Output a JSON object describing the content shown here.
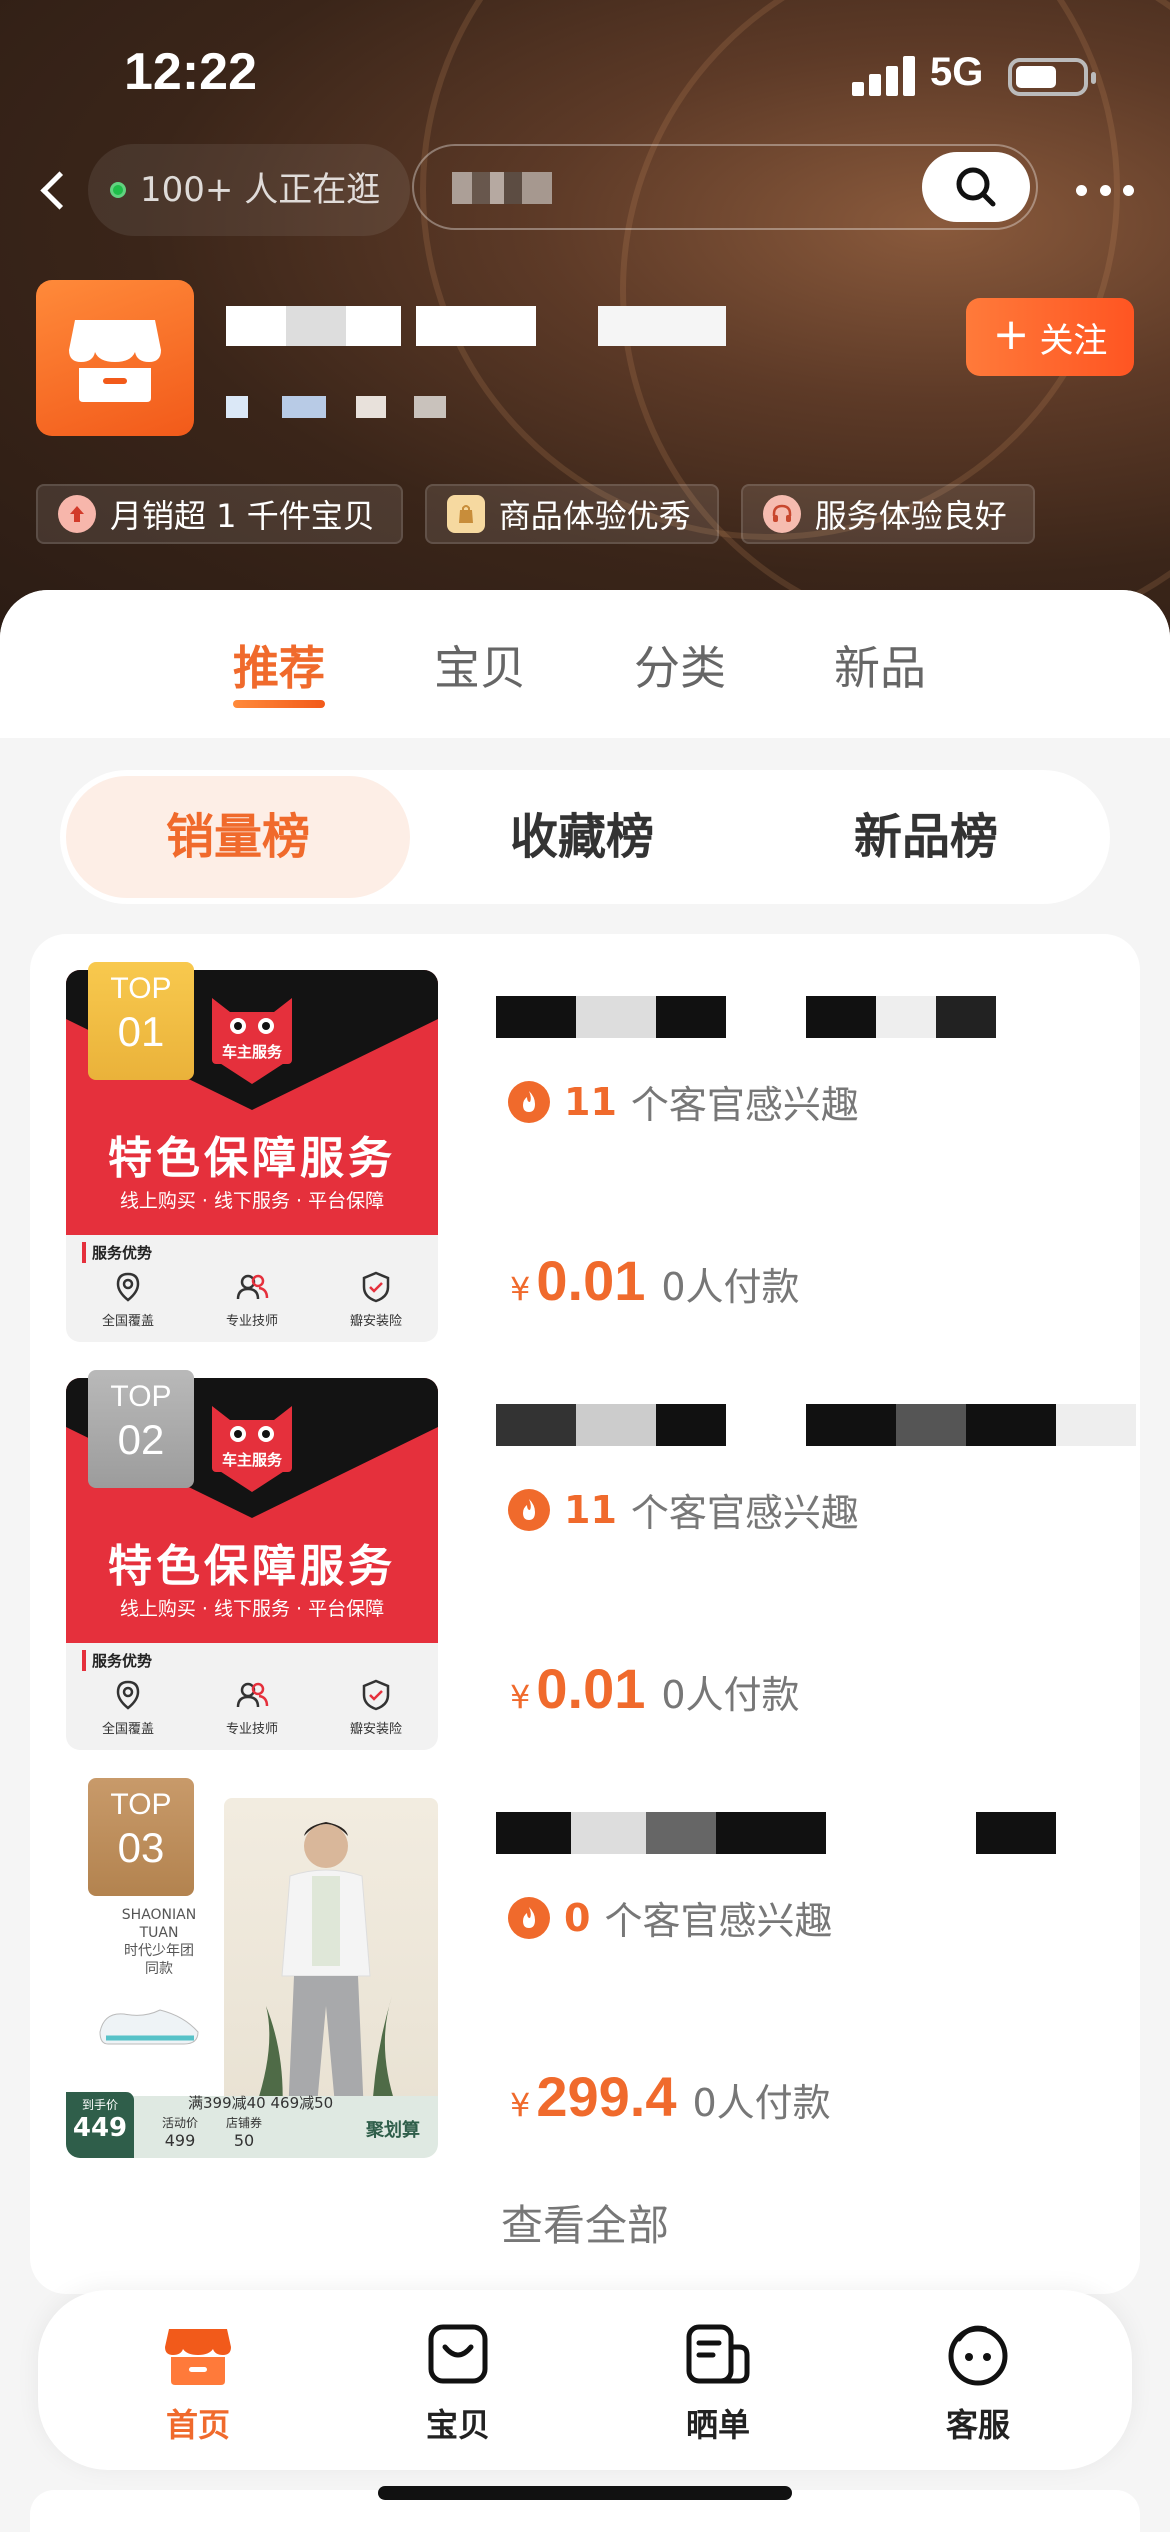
{
  "status_bar": {
    "time": "12:22",
    "network": "5G"
  },
  "nav": {
    "visitors": "100+ 人正在逛",
    "search_placeholder": "",
    "back": "back",
    "more": "more"
  },
  "shop": {
    "name": "",
    "subtitle": "",
    "follow_label": "关注",
    "follow_icon": "plus-icon"
  },
  "badges": [
    {
      "label": "月销超 1 千件宝贝",
      "icon": "arrow-up-icon"
    },
    {
      "label": "商品体验优秀",
      "icon": "shopping-bag-icon"
    },
    {
      "label": "服务体验良好",
      "icon": "headset-icon"
    }
  ],
  "tabs": [
    {
      "label": "推荐",
      "active": true
    },
    {
      "label": "宝贝",
      "active": false
    },
    {
      "label": "分类",
      "active": false
    },
    {
      "label": "新品",
      "active": false
    }
  ],
  "rank_tabs": [
    {
      "label": "销量榜",
      "active": true
    },
    {
      "label": "收藏榜",
      "active": false
    },
    {
      "label": "新品榜",
      "active": false
    }
  ],
  "products": [
    {
      "rank_top": "TOP",
      "rank_no": "01",
      "thumb": {
        "brand": "车主服务",
        "title": "特色保障服务",
        "subtitle": "线上购买 · 线下服务 · 平台保障",
        "adv_label": "服务优势",
        "advs": [
          "全国覆盖",
          "专业技师",
          "瓣安装险"
        ]
      },
      "interest_count": "11",
      "interest_text": "个客官感兴趣",
      "currency": "¥",
      "price": "0.01",
      "paid": "0人付款"
    },
    {
      "rank_top": "TOP",
      "rank_no": "02",
      "thumb": {
        "brand": "车主服务",
        "title": "特色保障服务",
        "subtitle": "线上购买 · 线下服务 · 平台保障",
        "adv_label": "服务优势",
        "advs": [
          "全国覆盖",
          "专业技师",
          "瓣安装险"
        ]
      },
      "interest_count": "11",
      "interest_text": "个客官感兴趣",
      "currency": "¥",
      "price": "0.01",
      "paid": "0人付款"
    },
    {
      "rank_top": "TOP",
      "rank_no": "03",
      "thumb": {
        "brand_line1": "SHAONIAN",
        "brand_line2": "TUAN",
        "brand_line3": "时代少年团",
        "brand_line4": "同款",
        "promo": "满399减40 469减50",
        "hand_price_label": "到手价",
        "hand_price": "449",
        "act_label": "活动价",
        "act_price": "499",
        "coupon_label": "店铺券",
        "coupon": "50",
        "juhuasuan": "聚划算"
      },
      "interest_count": "0",
      "interest_text": "个客官感兴趣",
      "currency": "¥",
      "price": "299.4",
      "paid": "0人付款"
    }
  ],
  "view_all": "查看全部",
  "bottom_nav": [
    {
      "label": "首页",
      "icon": "shop-home-icon",
      "active": true
    },
    {
      "label": "宝贝",
      "icon": "bag-icon",
      "active": false
    },
    {
      "label": "晒单",
      "icon": "review-icon",
      "active": false
    },
    {
      "label": "客服",
      "icon": "service-icon",
      "active": false
    }
  ]
}
